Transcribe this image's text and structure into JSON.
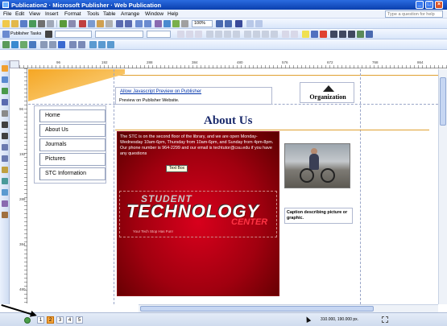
{
  "window": {
    "title": "Publication2 · Microsoft Publisher · Web Publication",
    "min_label": "_",
    "max_label": "□",
    "close_label": "×"
  },
  "menu": {
    "items": [
      "File",
      "Edit",
      "View",
      "Insert",
      "Format",
      "Tools",
      "Table",
      "Arrange",
      "Window",
      "Help"
    ],
    "help_placeholder": "Type a question for help"
  },
  "toolbar": {
    "zoom": "100%",
    "tasks_label": "Publisher Tasks",
    "style_value": "",
    "font_value": "",
    "size_value": ""
  },
  "ruler": {
    "h_labels": [
      "96",
      "192",
      "288",
      "384",
      "480",
      "576",
      "672",
      "768",
      "864"
    ],
    "v_labels": [
      "96",
      "192",
      "288",
      "384",
      "480"
    ]
  },
  "page": {
    "header_link": "Allow Javascript Preview on Publisher",
    "header_sub": "Preview on Publisher Website.",
    "logo_text": "Organization",
    "nav": [
      "Home",
      "About Us",
      "Journals",
      "Pictures",
      "STC Information"
    ],
    "heading": "About Us",
    "body_text": "The STC is on the second floor of the library, and we are open Monday-Wednesday 10am-6pm, Thursday from 10am-6pm, and Sunday from 4pm-8pm.  Our phone number is 964-2299 and our email is techtutor@csu.edu if you have any questions",
    "textbox_tip": "Text Box",
    "logo_line1": "STUDENT",
    "logo_line2": "TECHNOLOGY",
    "logo_line3": "CENTER",
    "logo_tagline": "Your Tech Stop Has Fun!",
    "caption": "Caption describing picture or graphic."
  },
  "status": {
    "pages": [
      "1",
      "2",
      "3",
      "4",
      "5"
    ],
    "active_page": "2",
    "coords": "310.000, 190.000 px."
  },
  "colors": {
    "accent_orange": "#f5a623",
    "panel_red": "#c0001a",
    "heading_navy": "#1a2a6c",
    "titlebar_blue": "#0a3fae"
  },
  "icons": [
    "app-icon",
    "save-icon",
    "print-icon",
    "search-icon",
    "cursor-icon",
    "size-icon",
    "arrow-annotation"
  ]
}
